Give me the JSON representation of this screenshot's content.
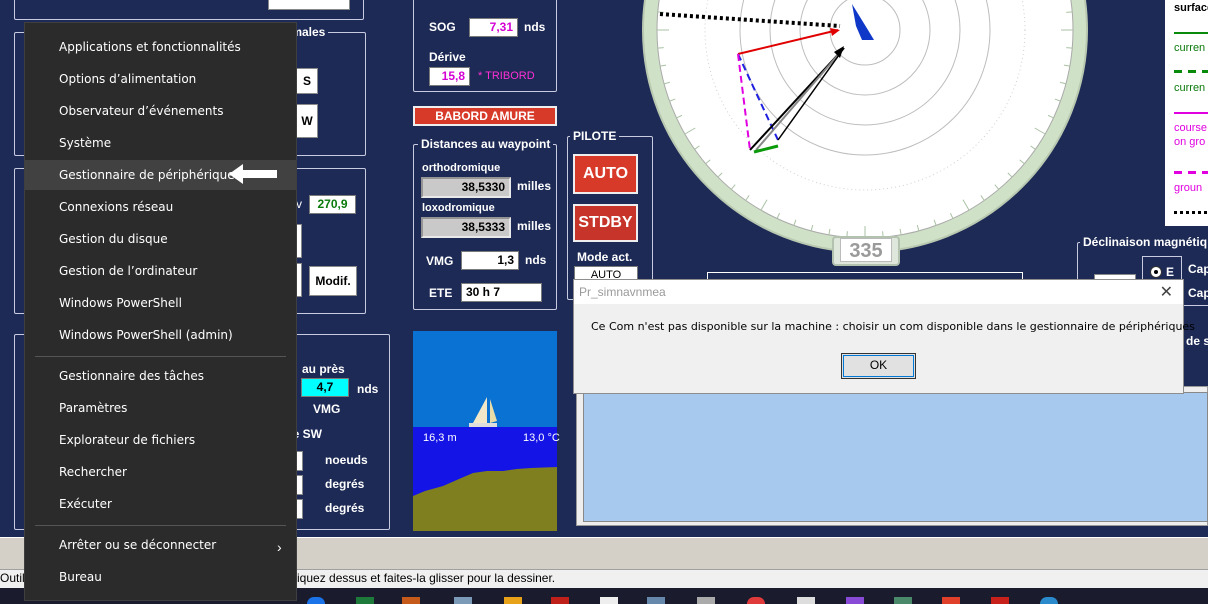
{
  "start_menu": {
    "items": [
      {
        "label": "Applications et fonctionnalités"
      },
      {
        "label": "Options d’alimentation"
      },
      {
        "label": "Observateur d’événements"
      },
      {
        "label": "Système"
      },
      {
        "label": "Gestionnaire de périphériques"
      },
      {
        "label": "Connexions réseau"
      },
      {
        "label": "Gestion du disque"
      },
      {
        "label": "Gestion de l’ordinateur"
      },
      {
        "label": "Windows PowerShell"
      },
      {
        "label": "Windows PowerShell (admin)"
      },
      {
        "label": "Gestionnaire des tâches"
      },
      {
        "label": "Paramètres"
      },
      {
        "label": "Explorateur de fichiers"
      },
      {
        "label": "Rechercher"
      },
      {
        "label": "Exécuter"
      },
      {
        "label": "Arrêter ou se déconnecter"
      },
      {
        "label": "Bureau"
      }
    ],
    "highlighted_index": 4
  },
  "left_panel": {
    "group_title_partial": "imales",
    "btn_s": "S",
    "btn_w": "W",
    "field_2709": "270,9",
    "label_v": "v",
    "modif_label": "Modif.",
    "aupres_label": "au près",
    "aupres_value": "4,7",
    "aupres_unit": "nds",
    "vmg_label": "VMG",
    "sw_title_partial": "ce SW",
    "unit_noeuds": "noeuds",
    "unit_degres1": "degrés",
    "unit_degres2": "degrés"
  },
  "nav": {
    "sog_label": "SOG",
    "sog_value": "7,31",
    "sog_unit": "nds",
    "derive_label": "Dérive",
    "derive_value": "15,8",
    "derive_side": "* TRIBORD",
    "babord_label": "BABORD AMURE"
  },
  "waypoint": {
    "title": "Distances au waypoint",
    "ortho_label": "orthodromique",
    "ortho_value": "38,5330",
    "ortho_unit": "milles",
    "loxo_label": "loxodromique",
    "loxo_value": "38,5333",
    "loxo_unit": "milles",
    "vmg_label": "VMG",
    "vmg_value": "1,3",
    "vmg_unit": "nds",
    "ete_label": "ETE",
    "ete_value": "30 h 7"
  },
  "pilote": {
    "title": "PILOTE",
    "auto_label": "AUTO",
    "stdby_label": "STDBY",
    "mode_label": "Mode act.",
    "mode_value": "AUTO"
  },
  "compass": {
    "heading": "335"
  },
  "depth": {
    "depth_label": "16,3 m",
    "temp_label": "13,0 °C"
  },
  "legend": {
    "items": [
      "surface",
      "curren",
      "curren",
      "course",
      "on gro",
      "groun"
    ]
  },
  "declinaison": {
    "title": "Déclinaison magnétiq",
    "radio_e": "E",
    "cap1": "Cap",
    "cap2": "Cap",
    "de_partial": "de s"
  },
  "dialog": {
    "title": "Pr_simnavnmea",
    "message": "Ce Com n'est pas disponible sur la machine : choisir un com disponible dans le gestionnaire de périphériques",
    "ok": "OK"
  },
  "status_bar": {
    "left": "Outil",
    "text": "iquez dessus et faites-la glisser pour la dessiner."
  }
}
